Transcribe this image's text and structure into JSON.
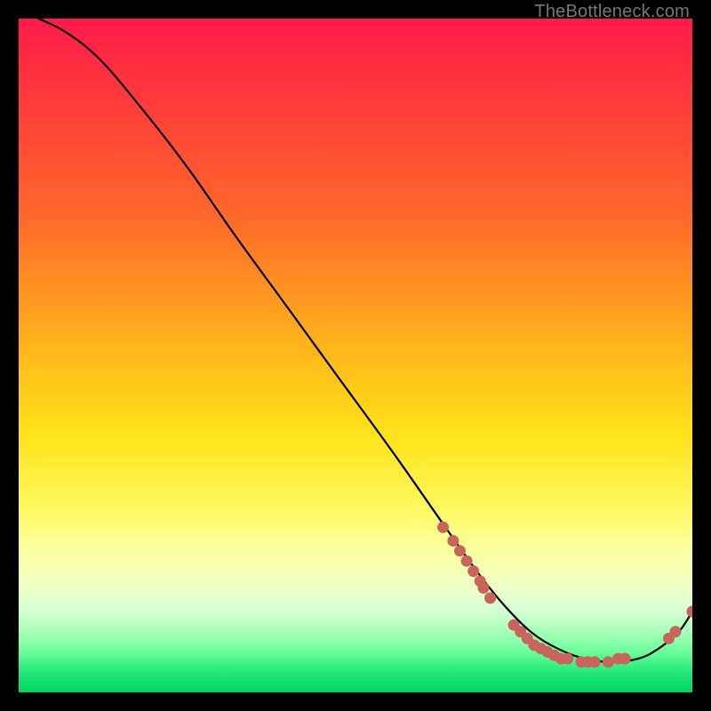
{
  "watermark": "TheBottleneck.com",
  "chart_data": {
    "type": "line",
    "title": "",
    "xlabel": "",
    "ylabel": "",
    "xlim": [
      0,
      100
    ],
    "ylim": [
      0,
      100
    ],
    "series": [
      {
        "name": "curve",
        "x": [
          3,
          7,
          12,
          18,
          25,
          32,
          40,
          48,
          56,
          63,
          68,
          72,
          76,
          80,
          84,
          88,
          92,
          95,
          98,
          100
        ],
        "y": [
          100,
          98,
          94,
          87,
          78,
          68,
          57,
          46,
          35,
          25,
          18,
          13,
          9,
          6.5,
          5,
          4.5,
          5,
          6.5,
          9,
          12
        ]
      }
    ],
    "markers": [
      {
        "x": 63.0,
        "y": 24.5
      },
      {
        "x": 64.5,
        "y": 22.5
      },
      {
        "x": 65.5,
        "y": 21.0
      },
      {
        "x": 66.5,
        "y": 19.5
      },
      {
        "x": 67.5,
        "y": 18.0
      },
      {
        "x": 68.5,
        "y": 16.5
      },
      {
        "x": 69.0,
        "y": 15.5
      },
      {
        "x": 70.0,
        "y": 14.0
      },
      {
        "x": 73.5,
        "y": 10.0
      },
      {
        "x": 74.5,
        "y": 9.0
      },
      {
        "x": 75.5,
        "y": 8.0
      },
      {
        "x": 76.5,
        "y": 7.0
      },
      {
        "x": 77.5,
        "y": 6.5
      },
      {
        "x": 78.5,
        "y": 6.0
      },
      {
        "x": 79.5,
        "y": 5.5
      },
      {
        "x": 80.5,
        "y": 5.0
      },
      {
        "x": 81.5,
        "y": 5.0
      },
      {
        "x": 83.5,
        "y": 4.5
      },
      {
        "x": 84.5,
        "y": 4.5
      },
      {
        "x": 85.5,
        "y": 4.5
      },
      {
        "x": 87.5,
        "y": 4.5
      },
      {
        "x": 89.0,
        "y": 5.0
      },
      {
        "x": 90.0,
        "y": 5.0
      },
      {
        "x": 96.5,
        "y": 8.0
      },
      {
        "x": 97.5,
        "y": 9.0
      },
      {
        "x": 100.0,
        "y": 12.0
      }
    ],
    "colors": {
      "line": "#000000",
      "marker": "#c9645a"
    }
  }
}
